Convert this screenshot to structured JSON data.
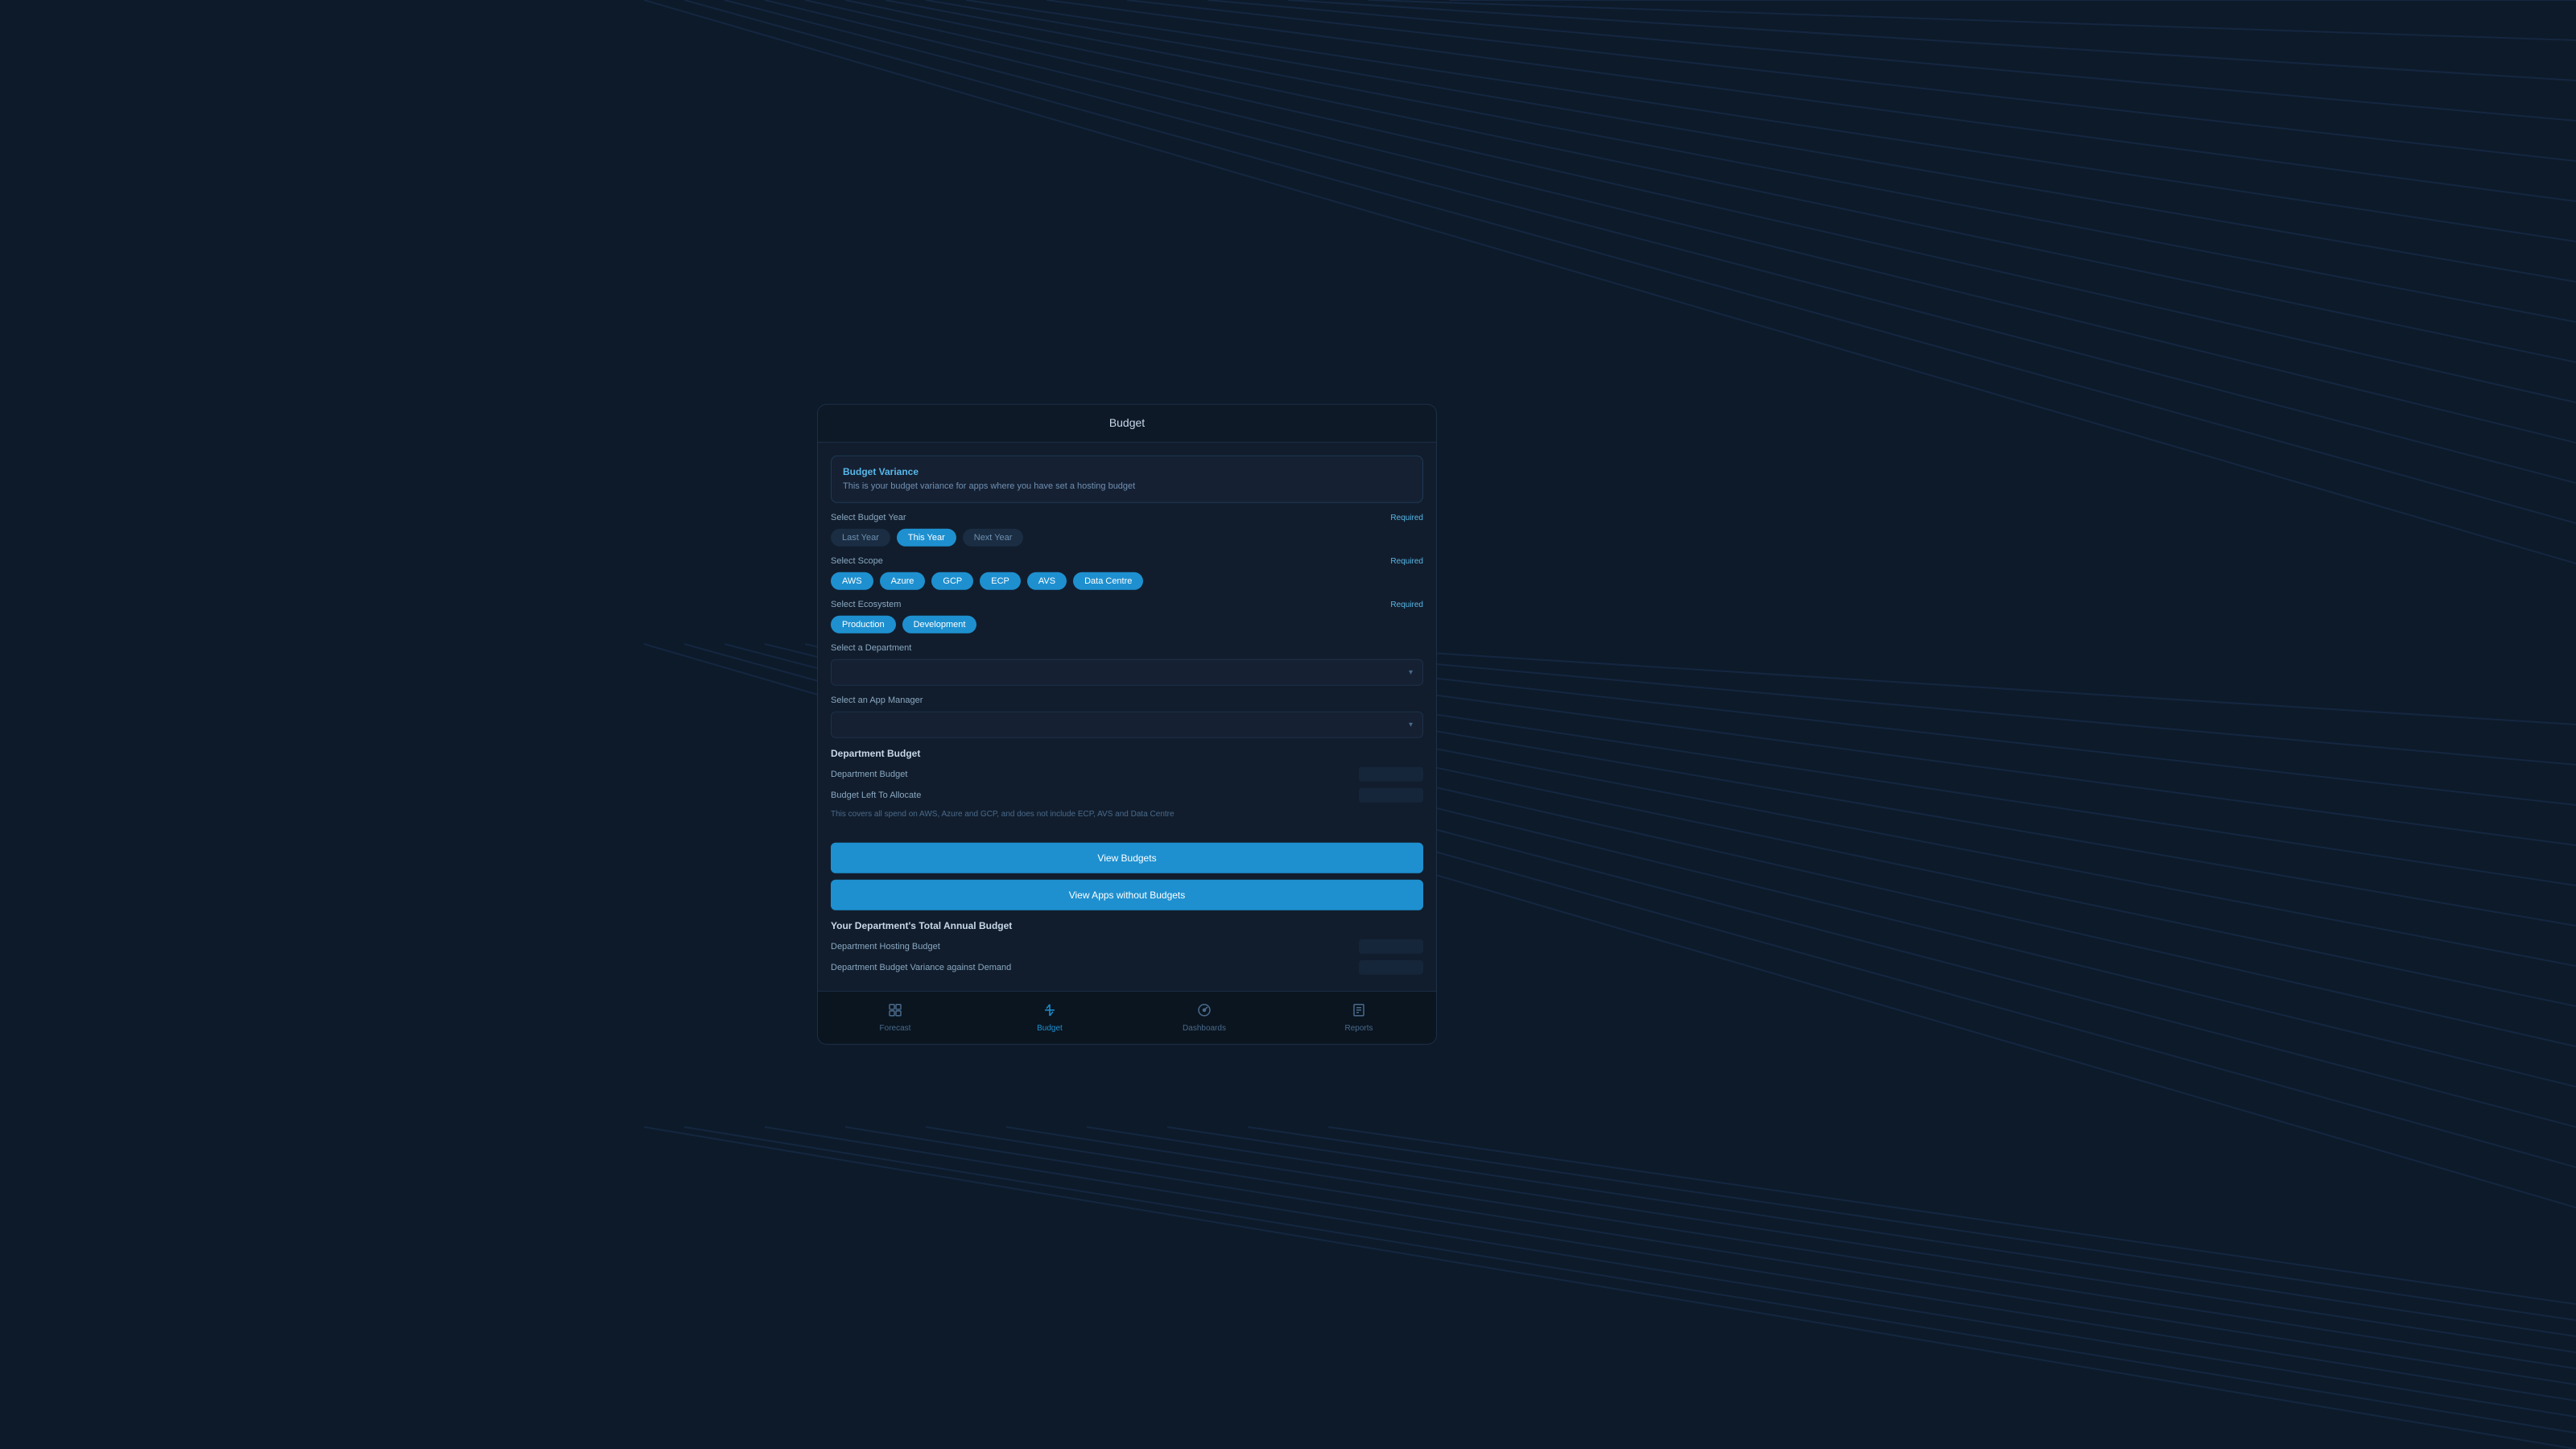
{
  "background": {
    "color": "#0d1a2a"
  },
  "modal": {
    "title": "Budget",
    "budget_variance": {
      "title": "Budget Variance",
      "description": "This is your budget variance for apps where you have set a hosting budget"
    },
    "select_budget_year": {
      "label": "Select Budget Year",
      "required": "Required",
      "options": [
        "Last Year",
        "This Year",
        "Next Year"
      ],
      "active": "This Year"
    },
    "select_scope": {
      "label": "Select Scope",
      "required": "Required",
      "options": [
        "AWS",
        "Azure",
        "GCP",
        "ECP",
        "AVS",
        "Data Centre"
      ],
      "active_all": true
    },
    "select_ecosystem": {
      "label": "Select Ecosystem",
      "required": "Required",
      "options": [
        "Production",
        "Development"
      ],
      "active_all": true
    },
    "select_department": {
      "label": "Select a Department",
      "placeholder": ""
    },
    "select_app_manager": {
      "label": "Select an App Manager",
      "placeholder": ""
    },
    "department_budget": {
      "title": "Department Budget",
      "rows": [
        {
          "label": "Department Budget",
          "value": ""
        },
        {
          "label": "Budget Left To Allocate",
          "value": ""
        }
      ],
      "note": "This covers all spend on AWS, Azure and GCP, and does not include ECP, AVS and Data Centre"
    },
    "buttons": {
      "view_budgets": "View Budgets",
      "view_apps_without_budgets": "View Apps without Budgets"
    },
    "annual_budget": {
      "title": "Your Department's Total Annual Budget",
      "rows": [
        {
          "label": "Department Hosting Budget",
          "value": ""
        },
        {
          "label": "Department Budget Variance against Demand",
          "value": ""
        }
      ]
    }
  },
  "nav": {
    "items": [
      {
        "id": "forecast",
        "label": "Forecast",
        "icon": "⊟",
        "active": false
      },
      {
        "id": "budget",
        "label": "Budget",
        "icon": "↑↓",
        "active": true
      },
      {
        "id": "dashboards",
        "label": "Dashboards",
        "icon": "⊞",
        "active": false
      },
      {
        "id": "reports",
        "label": "Reports",
        "icon": "◫",
        "active": false
      }
    ]
  }
}
